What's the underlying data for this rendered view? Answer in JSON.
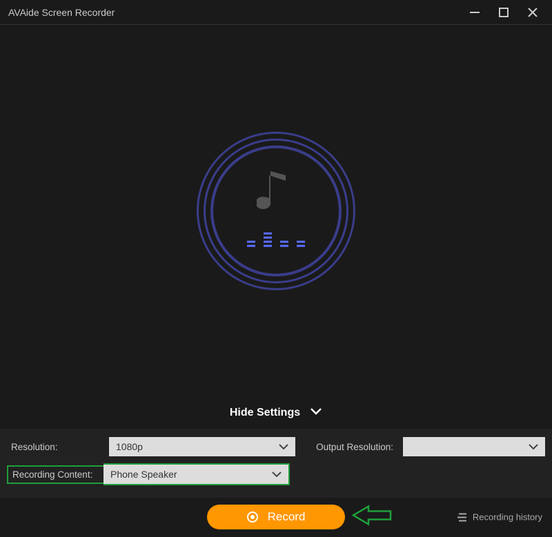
{
  "titlebar": {
    "app_title": "AVAide Screen Recorder"
  },
  "settings": {
    "hide_label": "Hide Settings",
    "resolution_label": "Resolution:",
    "resolution_value": "1080p",
    "output_resolution_label": "Output Resolution:",
    "output_resolution_value": "",
    "recording_content_label": "Recording Content:",
    "recording_content_value": "Phone Speaker"
  },
  "footer": {
    "record_label": "Record",
    "history_label": "Recording history"
  }
}
